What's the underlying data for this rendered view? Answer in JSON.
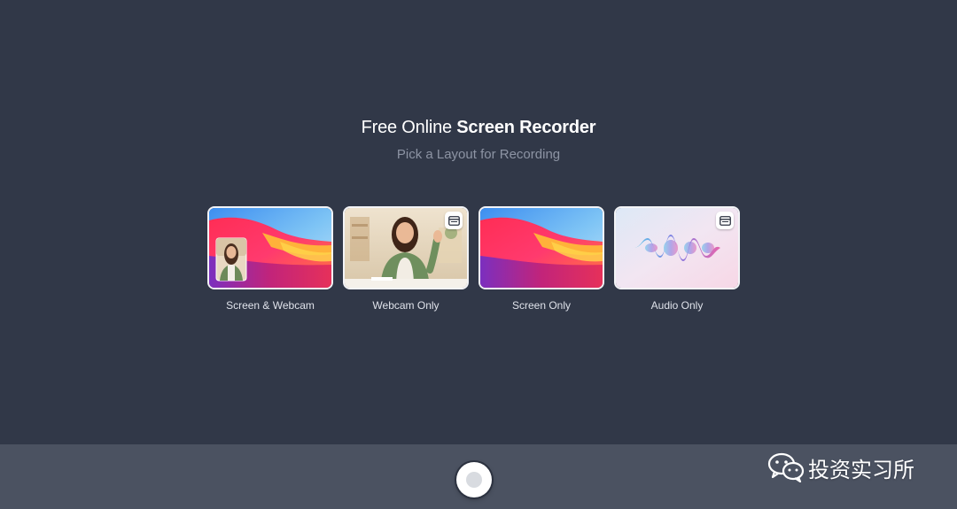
{
  "header": {
    "title_prefix": "Free Online",
    "title_strong": "Screen Recorder",
    "subtitle": "Pick a Layout for Recording"
  },
  "layouts": [
    {
      "label": "Screen & Webcam",
      "thumbnail": "screen-with-webcam-overlay",
      "badge": false
    },
    {
      "label": "Webcam Only",
      "thumbnail": "webcam-person",
      "badge": true,
      "badge_icon": "window-icon"
    },
    {
      "label": "Screen Only",
      "thumbnail": "screen-wallpaper",
      "badge": false
    },
    {
      "label": "Audio Only",
      "thumbnail": "audio-waveform",
      "badge": true,
      "badge_icon": "window-icon"
    }
  ],
  "controls": {
    "record_button_icon": "record-icon"
  },
  "watermark": {
    "icon": "wechat-icon",
    "text": "投资实习所"
  },
  "colors": {
    "background": "#313848",
    "bottom_bar": "#4b5261",
    "subtitle": "#8d94a4",
    "card_border": "#f2f3f6"
  }
}
